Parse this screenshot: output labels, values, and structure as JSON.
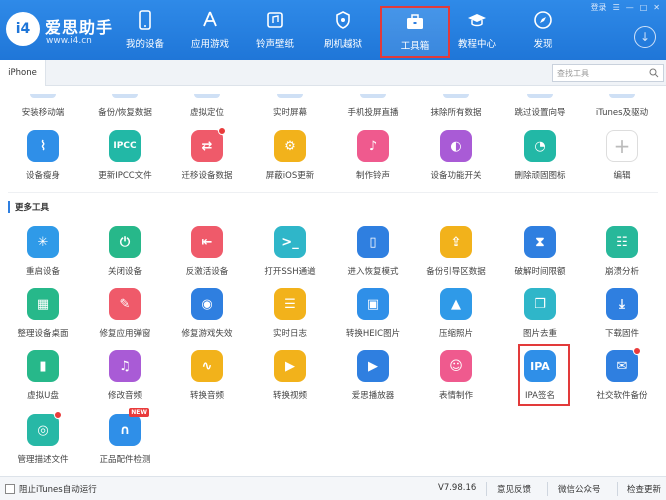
{
  "header": {
    "logo_text": "i4",
    "brand": "爱思助手",
    "url": "www.i4.cn",
    "window_controls": [
      "登录",
      "☰",
      "—",
      "□",
      "✕"
    ],
    "nav": [
      {
        "label": "我的设备",
        "icon": "phone-icon"
      },
      {
        "label": "应用游戏",
        "icon": "app-store-icon"
      },
      {
        "label": "铃声壁纸",
        "icon": "music-icon"
      },
      {
        "label": "刷机越狱",
        "icon": "shield-icon"
      },
      {
        "label": "工具箱",
        "icon": "toolbox-icon",
        "active": true
      },
      {
        "label": "教程中心",
        "icon": "graduation-cap-icon"
      },
      {
        "label": "发现",
        "icon": "compass-icon"
      }
    ]
  },
  "tabs": {
    "device": "iPhone"
  },
  "search": {
    "placeholder": "查找工具"
  },
  "top_row_labels": [
    "安装移动端",
    "备份/恢复数据",
    "虚拟定位",
    "实时屏幕",
    "手机投屏直播",
    "抹除所有数据",
    "跳过设置向导",
    "iTunes及驱动"
  ],
  "row1": [
    {
      "label": "设备瘦身",
      "icon": "broom-icon",
      "color": "#2f8fe8"
    },
    {
      "label": "更新IPCC文件",
      "icon": "ipcc-icon",
      "color": "#22b8a6",
      "text": "IPCC"
    },
    {
      "label": "迁移设备数据",
      "icon": "migrate-icon",
      "color": "#ef5a6a",
      "badge": true
    },
    {
      "label": "屏蔽iOS更新",
      "icon": "gear-icon",
      "color": "#f2b21b"
    },
    {
      "label": "制作铃声",
      "icon": "music-note-icon",
      "color": "#ef5a8e"
    },
    {
      "label": "设备功能开关",
      "icon": "toggle-icon",
      "color": "#a95bd6"
    },
    {
      "label": "删除顽固图标",
      "icon": "pie-icon",
      "color": "#22b8a6"
    },
    {
      "label": "编辑",
      "icon": "plus-icon",
      "color": "#ffffff"
    }
  ],
  "section_title": "更多工具",
  "row2": [
    {
      "label": "重启设备",
      "icon": "spinner-icon",
      "color": "#2f9ae8"
    },
    {
      "label": "关闭设备",
      "icon": "power-icon",
      "color": "#27b88a"
    },
    {
      "label": "反激活设备",
      "icon": "deactivate-icon",
      "color": "#ef5a6a"
    },
    {
      "label": "打开SSH通道",
      "icon": "terminal-icon",
      "color": "#2fb6c9"
    },
    {
      "label": "进入恢复模式",
      "icon": "recovery-icon",
      "color": "#2f7fe0"
    },
    {
      "label": "备份引导区数据",
      "icon": "backup-icon",
      "color": "#f2b21b"
    },
    {
      "label": "破解时间限额",
      "icon": "hourglass-icon",
      "color": "#2f7fe0"
    },
    {
      "label": "崩溃分析",
      "icon": "crash-icon",
      "color": "#27b89a"
    }
  ],
  "row3": [
    {
      "label": "整理设备桌面",
      "icon": "grid-icon",
      "color": "#27b88a"
    },
    {
      "label": "修复应用弹窗",
      "icon": "repair-icon",
      "color": "#ef5a6a"
    },
    {
      "label": "修复游戏失效",
      "icon": "gamepad-icon",
      "color": "#2f7fe0"
    },
    {
      "label": "实时日志",
      "icon": "log-icon",
      "color": "#f2b21b"
    },
    {
      "label": "转换HEIC图片",
      "icon": "image-convert-icon",
      "color": "#2f8fe8"
    },
    {
      "label": "压缩照片",
      "icon": "photo-icon",
      "color": "#2f9ae8"
    },
    {
      "label": "图片去重",
      "icon": "dedupe-icon",
      "color": "#2fb6c9"
    },
    {
      "label": "下载固件",
      "icon": "download-firmware-icon",
      "color": "#2f7fe0"
    }
  ],
  "row4": [
    {
      "label": "虚拟U盘",
      "icon": "usb-icon",
      "color": "#27b88a"
    },
    {
      "label": "修改音频",
      "icon": "audio-edit-icon",
      "color": "#a95bd6"
    },
    {
      "label": "转换音频",
      "icon": "waveform-icon",
      "color": "#f2b21b"
    },
    {
      "label": "转换视频",
      "icon": "video-convert-icon",
      "color": "#f2b21b"
    },
    {
      "label": "爱思播放器",
      "icon": "play-icon",
      "color": "#2f7fe0"
    },
    {
      "label": "表情制作",
      "icon": "emoji-icon",
      "color": "#ef5a8e"
    },
    {
      "label": "IPA签名",
      "icon": "ipa-icon",
      "color": "#2f8fe8",
      "text": "IPA"
    },
    {
      "label": "社交软件备份",
      "icon": "chat-backup-icon",
      "color": "#2f7fe0",
      "badge": true
    }
  ],
  "row5": [
    {
      "label": "管理描述文件",
      "icon": "profile-icon",
      "color": "#27b8a6",
      "badge": true
    },
    {
      "label": "正品配件检测",
      "icon": "earphone-icon",
      "color": "#2f8fe8",
      "tag": "NEW"
    }
  ],
  "footer": {
    "checkbox_label": "阻止iTunes自动运行",
    "version": "V7.98.16",
    "feedback": "意见反馈",
    "wechat": "微信公众号",
    "update": "检查更新"
  }
}
